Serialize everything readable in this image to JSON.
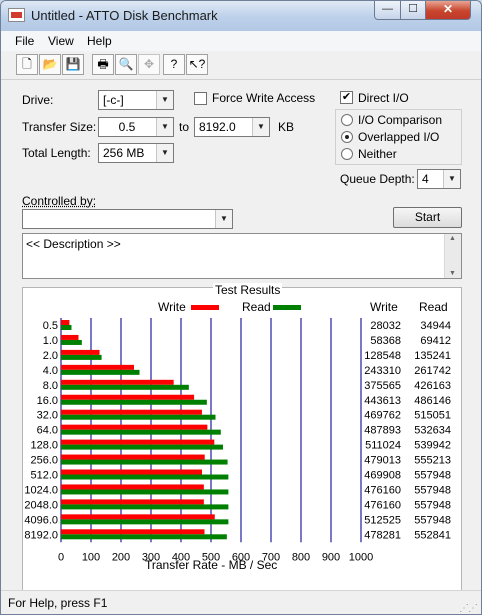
{
  "window": {
    "title": "Untitled - ATTO Disk Benchmark",
    "minimize": "—",
    "maximize": "☐",
    "close": "✕"
  },
  "menu": [
    "File",
    "View",
    "Help"
  ],
  "toolbar": [
    {
      "name": "new-document-icon",
      "glyph": "🗋"
    },
    {
      "name": "open-folder-icon",
      "glyph": "📂"
    },
    {
      "name": "save-icon",
      "glyph": "💾"
    },
    {
      "name": "print-icon",
      "glyph": "🖶"
    },
    {
      "name": "print-preview-icon",
      "glyph": "🔍"
    },
    {
      "name": "move-cross-icon",
      "glyph": "✥"
    },
    {
      "name": "help-icon",
      "glyph": "?"
    },
    {
      "name": "context-help-icon",
      "glyph": "↖?"
    }
  ],
  "form": {
    "drive_label": "Drive:",
    "drive_value": "[-c-]",
    "force_write_label": "Force Write Access",
    "direct_io_label": "Direct I/O",
    "direct_io_checked": "✔",
    "transfer_size_label": "Transfer Size:",
    "transfer_from": "0.5",
    "to_label": "to",
    "transfer_to": "8192.0",
    "kb_label": "KB",
    "total_length_label": "Total Length:",
    "total_length_value": "256 MB",
    "io_comparison_label": "I/O Comparison",
    "overlapped_io_label": "Overlapped I/O",
    "neither_label": "Neither",
    "queue_depth_label": "Queue Depth:",
    "queue_depth_value": "4",
    "controlled_by_label": "Controlled by:",
    "controlled_by_value": "",
    "start_label": "Start",
    "description_text": "<< Description >>"
  },
  "results": {
    "title": "Test Results",
    "legend_write": "Write",
    "legend_read": "Read",
    "col_write": "Write",
    "col_read": "Read",
    "axis_label": "Transfer Rate - MB / Sec",
    "write_color": "#ff0000",
    "read_color": "#008000"
  },
  "chart_data": {
    "type": "bar",
    "orientation": "horizontal",
    "categories": [
      "0.5",
      "1.0",
      "2.0",
      "4.0",
      "8.0",
      "16.0",
      "32.0",
      "64.0",
      "128.0",
      "256.0",
      "512.0",
      "1024.0",
      "2048.0",
      "4096.0",
      "8192.0"
    ],
    "series": [
      {
        "name": "Write",
        "values": [
          28032,
          58368,
          128548,
          243310,
          375565,
          443613,
          469762,
          487893,
          511024,
          479013,
          469908,
          476160,
          476160,
          512525,
          478281
        ]
      },
      {
        "name": "Read",
        "values": [
          34944,
          69412,
          135241,
          261742,
          426163,
          486146,
          515051,
          532634,
          539942,
          555213,
          557948,
          557948,
          557948,
          557948,
          552841
        ]
      }
    ],
    "xlabel": "Transfer Rate - MB / Sec",
    "xlim": [
      0,
      1000
    ],
    "xticks": [
      0,
      100,
      200,
      300,
      400,
      500,
      600,
      700,
      800,
      900,
      1000
    ],
    "grid": true
  },
  "status": {
    "text": "For Help, press F1"
  }
}
